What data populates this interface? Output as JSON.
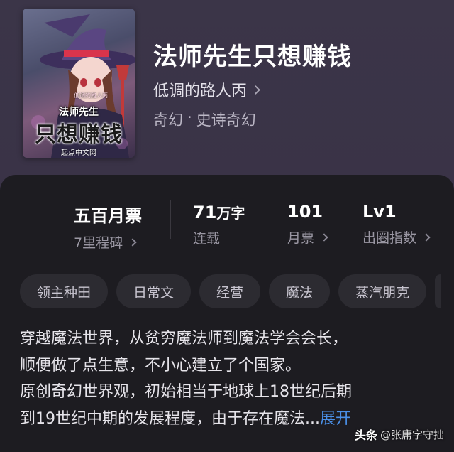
{
  "book": {
    "title": "法师先生只想赚钱",
    "author": "低调的路人丙",
    "genre_main": "奇幻",
    "genre_sep": "·",
    "genre_sub": "史诗奇幻"
  },
  "cover": {
    "series_label": "法师先生",
    "title_art": "只想赚钱",
    "author_tag": "低调的路人丙",
    "brand": "起点中文网"
  },
  "stats": {
    "milestone": {
      "value": "五百月票",
      "label": "7里程碑"
    },
    "words": {
      "value_num": "71",
      "value_unit": "万字",
      "label": "连载"
    },
    "monthly_tickets": {
      "value": "101",
      "label": "月票"
    },
    "breakout": {
      "value": "Lv1",
      "label": "出圈指数"
    }
  },
  "tags": [
    "领主种田",
    "日常文",
    "经营",
    "魔法",
    "蒸汽朋克"
  ],
  "description": {
    "line1": "穿越魔法世界，从贫穷魔法师到魔法学会会长，",
    "line2": "顺便做了点生意，不小心建立了个国家。",
    "line3": "原创奇幻世界观，初始相当于地球上18世纪后期",
    "line4": "到19世纪中期的发展程度，由于存在魔法...",
    "expand": "展开"
  },
  "watermark": {
    "brand": "头条",
    "handle": "@张庸字守拙"
  },
  "colors": {
    "accent_link": "#4a8fe7",
    "card_bg": "#1d1c21",
    "tag_bg": "#2c2b31"
  }
}
